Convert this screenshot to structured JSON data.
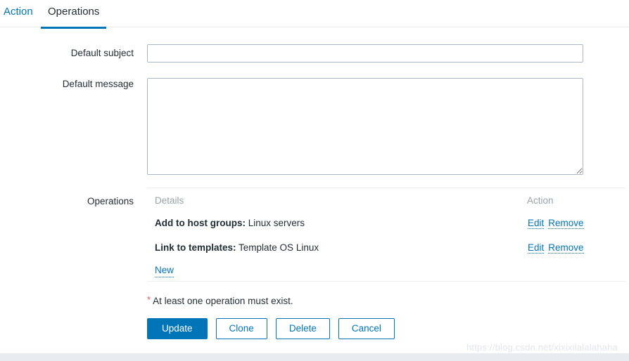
{
  "tabs": [
    {
      "label": "Action",
      "active": false
    },
    {
      "label": "Operations",
      "active": true
    }
  ],
  "form": {
    "subject": {
      "label": "Default subject",
      "value": "",
      "placeholder": ""
    },
    "message": {
      "label": "Default message",
      "value": "",
      "placeholder": ""
    },
    "operations": {
      "label": "Operations",
      "columns": {
        "details": "Details",
        "action": "Action"
      },
      "rows": [
        {
          "title": "Add to host groups:",
          "value": "Linux servers",
          "edit": "Edit",
          "remove": "Remove"
        },
        {
          "title": "Link to templates:",
          "value": "Template OS Linux",
          "edit": "Edit",
          "remove": "Remove"
        }
      ],
      "new_link": "New"
    },
    "hint": {
      "marker": "*",
      "text": "At least one operation must exist."
    }
  },
  "buttons": {
    "update": "Update",
    "clone": "Clone",
    "delete": "Delete",
    "cancel": "Cancel"
  },
  "watermark": "https://blog.csdn.net/xixixilalalahaha",
  "colors": {
    "accent": "#0275b8",
    "text": "#1f2c33",
    "muted": "#97a3ab",
    "required": "#e45959",
    "border": "#ebeef0",
    "input_border": "#aab7c1",
    "footer": "#e8ecef",
    "watermark": "#dfe6ec"
  }
}
